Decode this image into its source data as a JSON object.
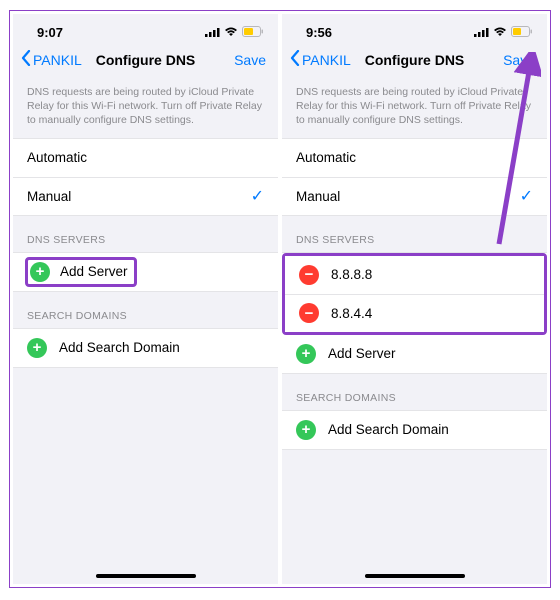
{
  "colors": {
    "accent": "#007aff",
    "highlight": "#8b3fc7",
    "green": "#34c759",
    "red": "#ff3b30"
  },
  "left": {
    "time": "9:07",
    "back_label": "PANKIL",
    "title": "Configure DNS",
    "save_label": "Save",
    "description": "DNS requests are being routed by iCloud Private Relay for this Wi-Fi network. Turn off Private Relay to manually configure DNS settings.",
    "options": {
      "automatic": "Automatic",
      "manual": "Manual"
    },
    "sections": {
      "dns_header": "DNS SERVERS",
      "add_server": "Add Server",
      "search_header": "SEARCH DOMAINS",
      "add_domain": "Add Search Domain"
    }
  },
  "right": {
    "time": "9:56",
    "back_label": "PANKIL",
    "title": "Configure DNS",
    "save_label": "Save",
    "description": "DNS requests are being routed by iCloud Private Relay for this Wi-Fi network. Turn off Private Relay to manually configure DNS settings.",
    "options": {
      "automatic": "Automatic",
      "manual": "Manual"
    },
    "sections": {
      "dns_header": "DNS SERVERS",
      "servers": [
        "8.8.8.8",
        "8.8.4.4"
      ],
      "add_server": "Add Server",
      "search_header": "SEARCH DOMAINS",
      "add_domain": "Add Search Domain"
    }
  }
}
